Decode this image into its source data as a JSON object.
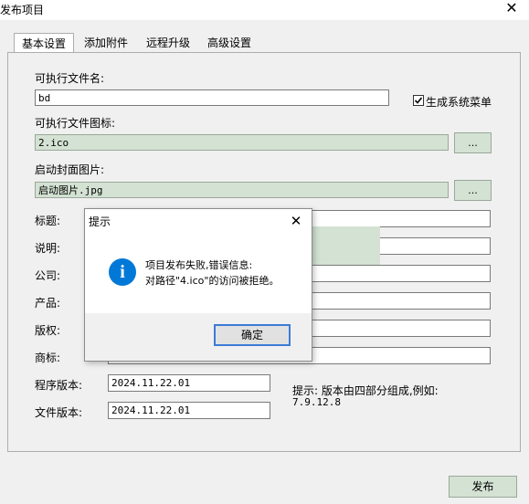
{
  "window": {
    "title": "发布项目"
  },
  "tabs": [
    "基本设置",
    "添加附件",
    "远程升级",
    "高级设置"
  ],
  "form": {
    "exe_name_label": "可执行文件名:",
    "exe_name_value": "bd",
    "gen_menu_label": "生成系统菜单",
    "exe_icon_label": "可执行文件图标:",
    "exe_icon_value": "2.ico",
    "browse_label": "...",
    "splash_label": "启动封面图片:",
    "splash_value": "启动图片.jpg",
    "title_label": "标题:",
    "desc_label": "说明:",
    "company_label": "公司:",
    "product_label": "产品:",
    "copyright_label": "版权:",
    "trademark_label": "商标:",
    "prog_version_label": "程序版本:",
    "prog_version_value": "2024.11.22.01",
    "file_version_label": "文件版本:",
    "file_version_value": "2024.11.22.01",
    "hint_line1": "提示: 版本由四部分组成,例如:",
    "hint_line2": "7.9.12.8"
  },
  "dialog": {
    "title": "提示",
    "message_line1": "项目发布失败,错误信息:",
    "message_line2": "对路径\"4.ico\"的访问被拒绝。",
    "ok_label": "确定",
    "icon": "info-icon"
  },
  "footer": {
    "publish_label": "发布"
  },
  "colors": {
    "accent": "#0078d7",
    "field_green": "#d3e2d3"
  }
}
